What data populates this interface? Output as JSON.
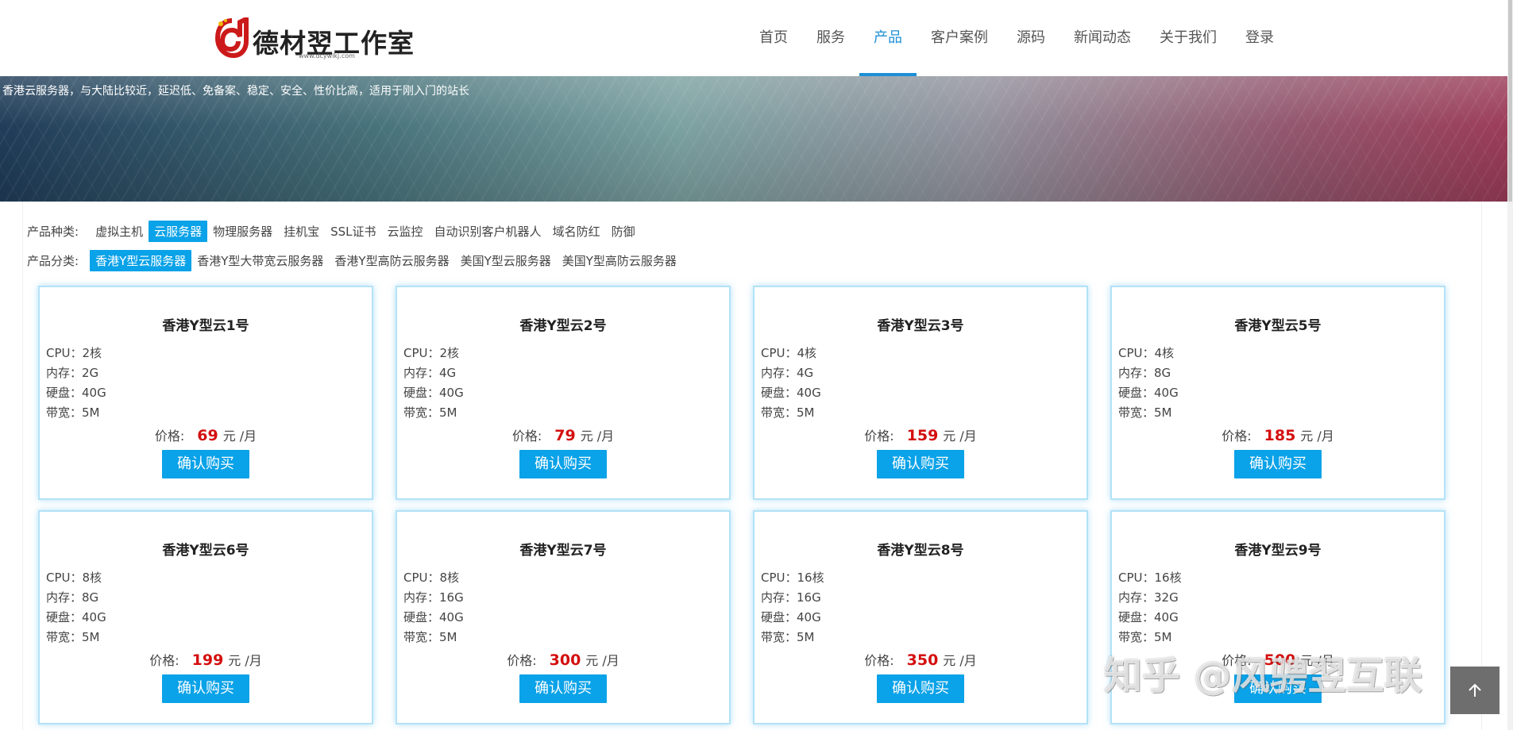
{
  "logo": {
    "text": "德材翌工作室",
    "sub": "www.dcywlkj.com"
  },
  "nav": {
    "items": [
      {
        "label": "首页",
        "active": false
      },
      {
        "label": "服务",
        "active": false
      },
      {
        "label": "产品",
        "active": true
      },
      {
        "label": "客户案例",
        "active": false
      },
      {
        "label": "源码",
        "active": false
      },
      {
        "label": "新闻动态",
        "active": false
      },
      {
        "label": "关于我们",
        "active": false
      },
      {
        "label": "登录",
        "active": false
      }
    ]
  },
  "banner": {
    "text": "香港云服务器，与大陆比较近，延迟低、免备案、稳定、安全、性价比高，适用于刚入门的站长"
  },
  "filters": {
    "type_label": "产品种类:",
    "types": [
      "虚拟主机",
      "云服务器",
      "物理服务器",
      "挂机宝",
      "SSL证书",
      "云监控",
      "自动识别客户机器人",
      "域名防红",
      "防御"
    ],
    "type_active": "云服务器",
    "category_label": "产品分类:",
    "categories": [
      "香港Y型云服务器",
      "香港Y型大带宽云服务器",
      "香港Y型高防云服务器",
      "美国Y型云服务器",
      "美国Y型高防云服务器"
    ],
    "category_active": "香港Y型云服务器"
  },
  "spec_labels": {
    "cpu": "CPU：",
    "ram": "内存：",
    "disk": "硬盘：",
    "bandwidth": "带宽：",
    "price": "价格:",
    "unit": "元 /月"
  },
  "buy_label": "确认购买",
  "products": [
    {
      "name": "香港Y型云1号",
      "cpu": "2核",
      "ram": "2G",
      "disk": "40G",
      "bandwidth": "5M",
      "price": "69"
    },
    {
      "name": "香港Y型云2号",
      "cpu": "2核",
      "ram": "4G",
      "disk": "40G",
      "bandwidth": "5M",
      "price": "79"
    },
    {
      "name": "香港Y型云3号",
      "cpu": "4核",
      "ram": "4G",
      "disk": "40G",
      "bandwidth": "5M",
      "price": "159"
    },
    {
      "name": "香港Y型云5号",
      "cpu": "4核",
      "ram": "8G",
      "disk": "40G",
      "bandwidth": "5M",
      "price": "185"
    },
    {
      "name": "香港Y型云6号",
      "cpu": "8核",
      "ram": "8G",
      "disk": "40G",
      "bandwidth": "5M",
      "price": "199"
    },
    {
      "name": "香港Y型云7号",
      "cpu": "8核",
      "ram": "16G",
      "disk": "40G",
      "bandwidth": "5M",
      "price": "300"
    },
    {
      "name": "香港Y型云8号",
      "cpu": "16核",
      "ram": "16G",
      "disk": "40G",
      "bandwidth": "5M",
      "price": "350"
    },
    {
      "name": "香港Y型云9号",
      "cpu": "16核",
      "ram": "32G",
      "disk": "40G",
      "bandwidth": "5M",
      "price": "500"
    }
  ],
  "watermark": "知乎 @风骋翌互联",
  "colors": {
    "accent": "#0aa2e8",
    "nav_active": "#1e8fd6",
    "price": "#d40f0f"
  },
  "icons": {
    "back_to_top": "arrow-up-icon"
  }
}
